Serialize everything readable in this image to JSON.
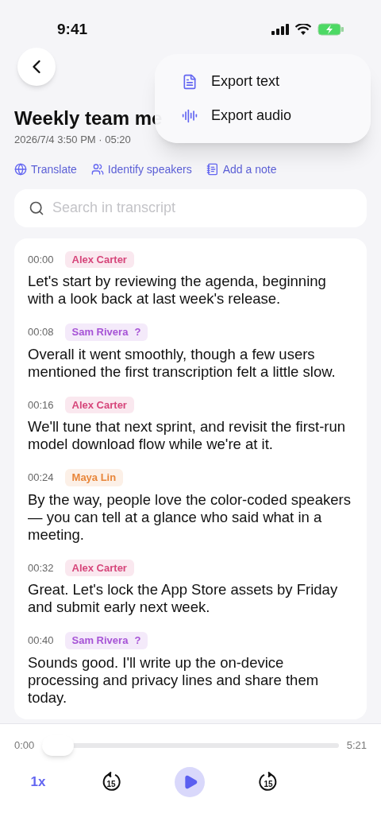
{
  "status_bar": {
    "time": "9:41"
  },
  "menu": {
    "items": [
      {
        "kind": "text",
        "label": "Export text"
      },
      {
        "kind": "audio",
        "label": "Export audio"
      }
    ]
  },
  "title": "Weekly team me",
  "meta": "2026/7/4 3:50 PM · 05:20",
  "actions": [
    {
      "kind": "globe",
      "label": "Translate"
    },
    {
      "kind": "people",
      "label": "Identify speakers"
    },
    {
      "kind": "note",
      "label": "Add a note"
    }
  ],
  "search": {
    "placeholder": "Search in transcript"
  },
  "transcript": [
    {
      "time": "00:00",
      "speaker": "Alex Carter",
      "color": "#d6457a",
      "text": "Let's start by reviewing the agenda, beginning with a look back at last week's release."
    },
    {
      "time": "00:08",
      "speaker": "Sam Rivera",
      "unsure_mark": "?",
      "color": "#a653d6",
      "text": "Overall it went smoothly, though a few users mentioned the first transcription felt a little slow."
    },
    {
      "time": "00:16",
      "speaker": "Alex Carter",
      "color": "#d6457a",
      "text": "We'll tune that next sprint, and revisit the first-run model download flow while we're at it."
    },
    {
      "time": "00:24",
      "speaker": "Maya Lin",
      "color": "#e8863a",
      "text": "By the way, people love the color-coded speakers — you can tell at a glance who said what in a meeting."
    },
    {
      "time": "00:32",
      "speaker": "Alex Carter",
      "color": "#d6457a",
      "text": "Great. Let's lock the App Store assets by Friday and submit early next week."
    },
    {
      "time": "00:40",
      "speaker": "Sam Rivera",
      "unsure_mark": "?",
      "color": "#a653d6",
      "text": "Sounds good. I'll write up the on-device processing and privacy lines and share them today."
    }
  ],
  "player": {
    "elapsed": "0:00",
    "total": "5:21",
    "level": 0,
    "speed": "1x",
    "skip_back": "15",
    "skip_forward": "15",
    "playing": false
  }
}
